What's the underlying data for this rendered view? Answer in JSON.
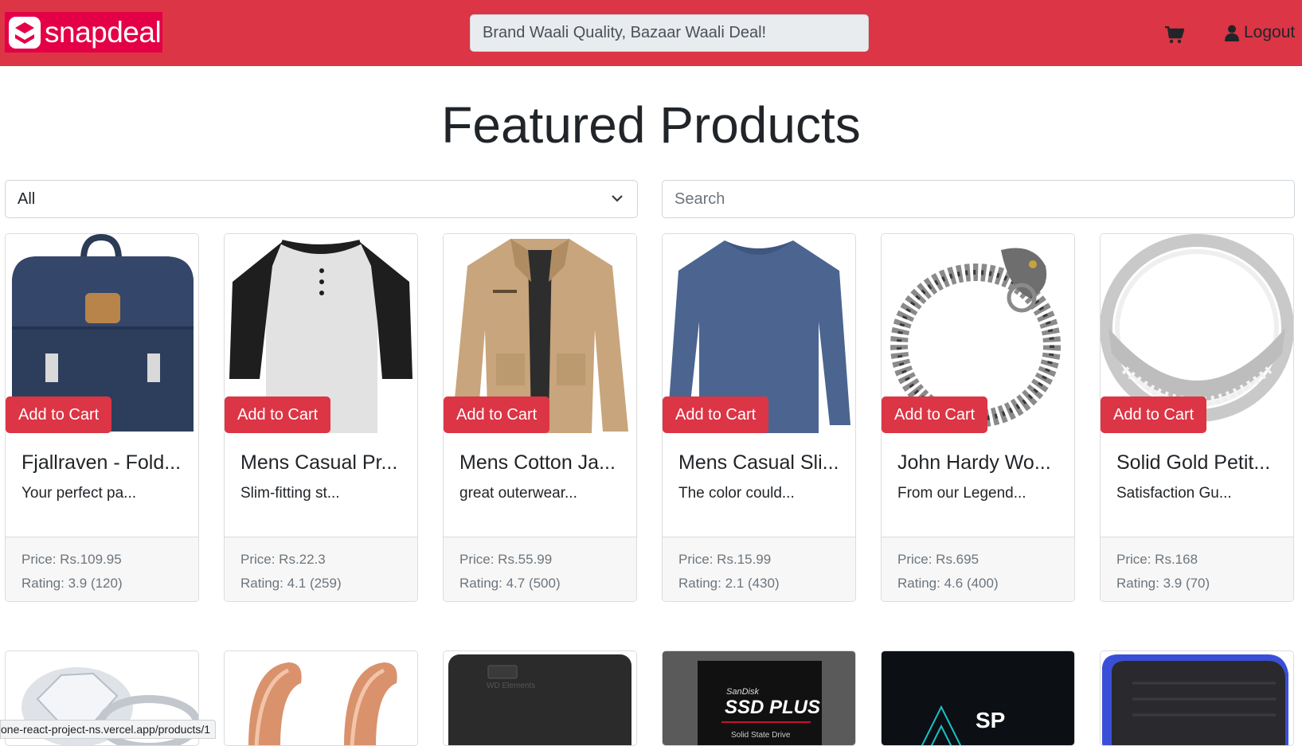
{
  "navbar": {
    "logo_text": "snapdeal",
    "search_placeholder": "Brand Waali Quality, Bazaar Waali Deal!",
    "cart_icon": "shopping-cart-icon",
    "logout_label": "Logout",
    "brand_color": "#dc3545"
  },
  "main": {
    "title": "Featured Products",
    "filter_value": "All",
    "search_placeholder": "Search",
    "add_to_cart_label": "Add to Cart"
  },
  "products": [
    {
      "title": "Fjallraven - Fold...",
      "desc": "Your perfect pa...",
      "price": "Price: Rs.109.95",
      "rating": "Rating: 3.9 (120)"
    },
    {
      "title": "Mens Casual Pr...",
      "desc": "Slim-fitting st...",
      "price": "Price: Rs.22.3",
      "rating": "Rating: 4.1 (259)"
    },
    {
      "title": "Mens Cotton Ja...",
      "desc": "great outerwear...",
      "price": "Price: Rs.55.99",
      "rating": "Rating: 4.7 (500)"
    },
    {
      "title": "Mens Casual Sli...",
      "desc": "The color could...",
      "price": "Price: Rs.15.99",
      "rating": "Rating: 2.1 (430)"
    },
    {
      "title": "John Hardy Wo...",
      "desc": "From our Legend...",
      "price": "Price: Rs.695",
      "rating": "Rating: 4.6 (400)"
    },
    {
      "title": "Solid Gold Petit...",
      "desc": "Satisfaction Gu...",
      "price": "Price: Rs.168",
      "rating": "Rating: 3.9 (70)"
    }
  ],
  "second_row_images": {
    "wd_label": "WD Elements",
    "sandisk_brand": "SanDisk",
    "sandisk_model": "SSD PLUS",
    "sandisk_sub": "Solid State Drive",
    "sp_logo": "SP"
  },
  "status_bar": {
    "url": "one-react-project-ns.vercel.app/products/1"
  }
}
